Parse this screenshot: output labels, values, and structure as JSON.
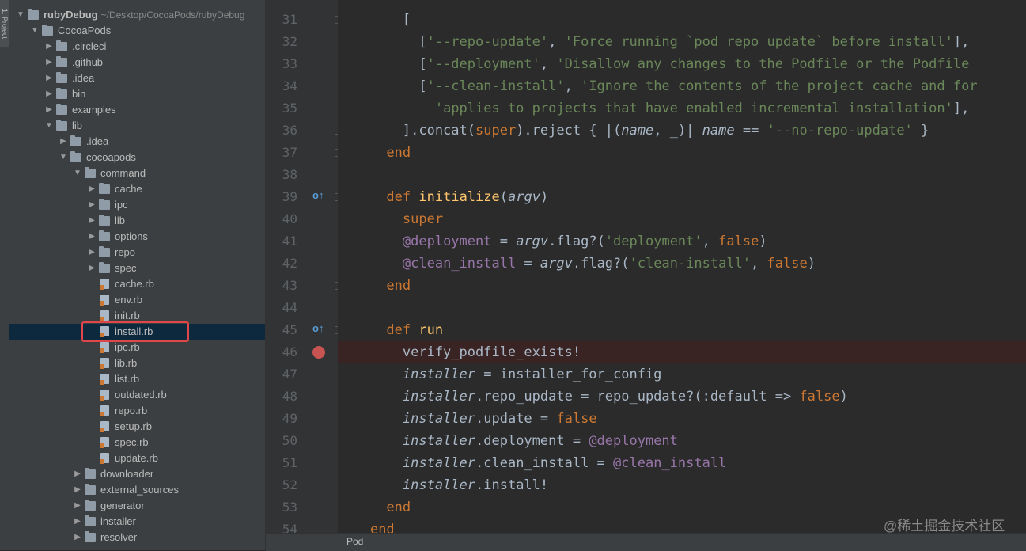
{
  "tool_strip": {
    "tab_label": "1: Project"
  },
  "tree": {
    "root": {
      "name": "rubyDebug",
      "path": "~/Desktop/CocoaPods/rubyDebug"
    },
    "rows": [
      {
        "label": "CocoaPods",
        "kind": "folder",
        "depth": 1,
        "expanded": true
      },
      {
        "label": ".circleci",
        "kind": "folder",
        "depth": 2,
        "expanded": false
      },
      {
        "label": ".github",
        "kind": "folder",
        "depth": 2,
        "expanded": false
      },
      {
        "label": ".idea",
        "kind": "folder",
        "depth": 2,
        "expanded": false
      },
      {
        "label": "bin",
        "kind": "folder",
        "depth": 2,
        "expanded": false
      },
      {
        "label": "examples",
        "kind": "folder",
        "depth": 2,
        "expanded": false
      },
      {
        "label": "lib",
        "kind": "folder",
        "depth": 2,
        "expanded": true
      },
      {
        "label": ".idea",
        "kind": "folder",
        "depth": 3,
        "expanded": false
      },
      {
        "label": "cocoapods",
        "kind": "folder",
        "depth": 3,
        "expanded": true
      },
      {
        "label": "command",
        "kind": "folder",
        "depth": 4,
        "expanded": true
      },
      {
        "label": "cache",
        "kind": "folder",
        "depth": 5,
        "expanded": false
      },
      {
        "label": "ipc",
        "kind": "folder",
        "depth": 5,
        "expanded": false
      },
      {
        "label": "lib",
        "kind": "folder",
        "depth": 5,
        "expanded": false
      },
      {
        "label": "options",
        "kind": "folder",
        "depth": 5,
        "expanded": false
      },
      {
        "label": "repo",
        "kind": "folder",
        "depth": 5,
        "expanded": false
      },
      {
        "label": "spec",
        "kind": "folder",
        "depth": 5,
        "expanded": false
      },
      {
        "label": "cache.rb",
        "kind": "file",
        "depth": 5
      },
      {
        "label": "env.rb",
        "kind": "file",
        "depth": 5
      },
      {
        "label": "init.rb",
        "kind": "file",
        "depth": 5
      },
      {
        "label": "install.rb",
        "kind": "file",
        "depth": 5,
        "selected": true
      },
      {
        "label": "ipc.rb",
        "kind": "file",
        "depth": 5
      },
      {
        "label": "lib.rb",
        "kind": "file",
        "depth": 5
      },
      {
        "label": "list.rb",
        "kind": "file",
        "depth": 5
      },
      {
        "label": "outdated.rb",
        "kind": "file",
        "depth": 5
      },
      {
        "label": "repo.rb",
        "kind": "file",
        "depth": 5
      },
      {
        "label": "setup.rb",
        "kind": "file",
        "depth": 5
      },
      {
        "label": "spec.rb",
        "kind": "file",
        "depth": 5
      },
      {
        "label": "update.rb",
        "kind": "file",
        "depth": 5
      },
      {
        "label": "downloader",
        "kind": "folder",
        "depth": 4,
        "expanded": false
      },
      {
        "label": "external_sources",
        "kind": "folder",
        "depth": 4,
        "expanded": false
      },
      {
        "label": "generator",
        "kind": "folder",
        "depth": 4,
        "expanded": false
      },
      {
        "label": "installer",
        "kind": "folder",
        "depth": 4,
        "expanded": false
      },
      {
        "label": "resolver",
        "kind": "folder",
        "depth": 4,
        "expanded": false
      }
    ]
  },
  "editor": {
    "lines": [
      {
        "n": "31",
        "code": "        ["
      },
      {
        "n": "32",
        "code": "          ['--repo-update', 'Force running `pod repo update` before install'],"
      },
      {
        "n": "33",
        "code": "          ['--deployment', 'Disallow any changes to the Podfile or the Podfile"
      },
      {
        "n": "34",
        "code": "          ['--clean-install', 'Ignore the contents of the project cache and for"
      },
      {
        "n": "35",
        "code": "            'applies to projects that have enabled incremental installation'],"
      },
      {
        "n": "36",
        "code": "        ].concat(super).reject { |(name, _)| name == '--no-repo-update' }"
      },
      {
        "n": "37",
        "code": "      end"
      },
      {
        "n": "38",
        "code": ""
      },
      {
        "n": "39",
        "code": "      def initialize(argv)"
      },
      {
        "n": "40",
        "code": "        super"
      },
      {
        "n": "41",
        "code": "        @deployment = argv.flag?('deployment', false)"
      },
      {
        "n": "42",
        "code": "        @clean_install = argv.flag?('clean-install', false)"
      },
      {
        "n": "43",
        "code": "      end"
      },
      {
        "n": "44",
        "code": ""
      },
      {
        "n": "45",
        "code": "      def run"
      },
      {
        "n": "46",
        "code": "        verify_podfile_exists!"
      },
      {
        "n": "47",
        "code": "        installer = installer_for_config"
      },
      {
        "n": "48",
        "code": "        installer.repo_update = repo_update?(:default => false)"
      },
      {
        "n": "49",
        "code": "        installer.update = false"
      },
      {
        "n": "50",
        "code": "        installer.deployment = @deployment"
      },
      {
        "n": "51",
        "code": "        installer.clean_install = @clean_install"
      },
      {
        "n": "52",
        "code": "        installer.install!"
      },
      {
        "n": "53",
        "code": "      end"
      },
      {
        "n": "54",
        "code": "    end"
      }
    ],
    "breakpoint_line": "46",
    "override_marker_lines": [
      "39",
      "45"
    ]
  },
  "statusbar": {
    "breadcrumb": "Pod"
  },
  "watermark": "@稀土掘金技术社区",
  "colors": {
    "keyword": "#cc7832",
    "string": "#6a8759",
    "ivar": "#9876aa",
    "method": "#ffc66d",
    "breakpoint": "#c75450",
    "selection": "#0d293e",
    "highlight_box": "#e0474b"
  }
}
